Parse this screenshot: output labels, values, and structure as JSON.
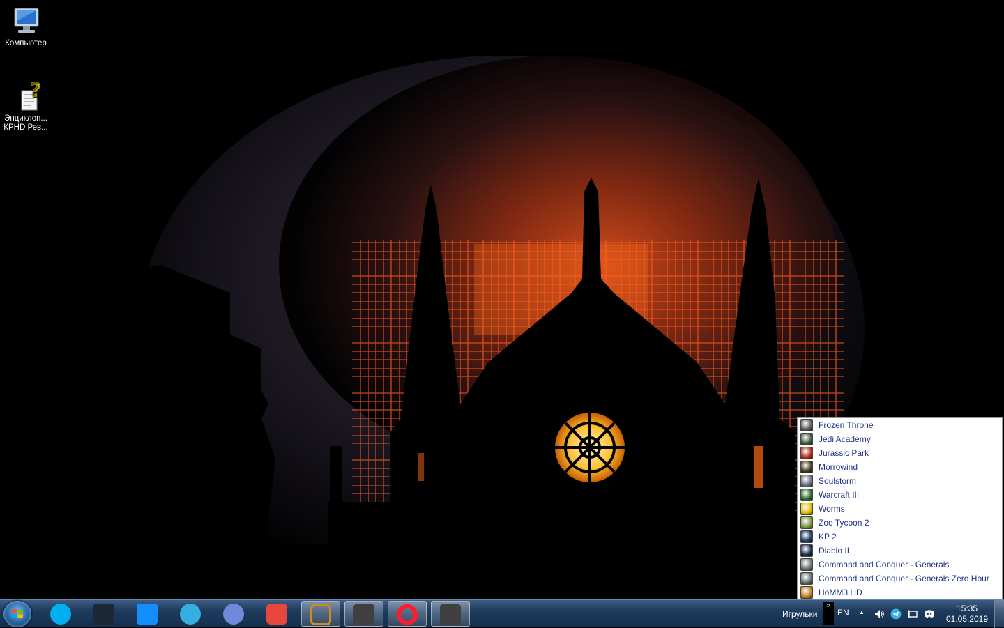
{
  "desktop": {
    "icons": [
      {
        "label": "Компьютер",
        "icon": "computer-icon"
      },
      {
        "label": "Энциклоп...",
        "label2": "КРHD Рев...",
        "icon": "encyclopedia-help-icon"
      }
    ]
  },
  "toolbar_menu": {
    "items": [
      {
        "label": "Frozen Throne",
        "icon": "frozen-throne-icon",
        "color": "#5a5a5a"
      },
      {
        "label": "Jedi Academy",
        "icon": "jedi-academy-icon",
        "color": "#3c5a3c"
      },
      {
        "label": "Jurassic Park",
        "icon": "jurassic-park-icon",
        "color": "#b03020"
      },
      {
        "label": "Morrowind",
        "icon": "morrowind-icon",
        "color": "#4a3a20"
      },
      {
        "label": "Soulstorm",
        "icon": "soulstorm-icon",
        "color": "#6a7080"
      },
      {
        "label": "Warcraft III",
        "icon": "warcraft-iii-icon",
        "color": "#2a6a2a"
      },
      {
        "label": "Worms",
        "icon": "worms-icon",
        "color": "#e0c000"
      },
      {
        "label": "Zoo Tycoon 2",
        "icon": "zoo-tycoon-icon",
        "color": "#7a9a40"
      },
      {
        "label": "KP 2",
        "icon": "kr2-icon",
        "color": "#203a6a"
      },
      {
        "label": "Diablo II",
        "icon": "diablo-ii-icon",
        "color": "#1a2a4a"
      },
      {
        "label": "Command and Conquer - Generals",
        "icon": "cnc-generals-icon",
        "color": "#707a70"
      },
      {
        "label": "Command and Conquer - Generals Zero Hour",
        "icon": "cnc-zero-hour-icon",
        "color": "#607070"
      },
      {
        "label": "HoMM3 HD",
        "icon": "homm3-icon",
        "color": "#c08020"
      }
    ]
  },
  "taskbar": {
    "pinned": [
      {
        "name": "skype",
        "icon": "skype-icon",
        "color": "#00aff0"
      },
      {
        "name": "steam",
        "icon": "steam-icon",
        "color": "#1b2838"
      },
      {
        "name": "battlenet",
        "icon": "battlenet-icon",
        "color": "#148eff"
      },
      {
        "name": "telegram",
        "icon": "telegram-icon",
        "color": "#37aee2"
      },
      {
        "name": "discord",
        "icon": "discord-icon",
        "color": "#7289da"
      },
      {
        "name": "app",
        "icon": "red-app-icon",
        "color": "#e8453c"
      },
      {
        "name": "switcher",
        "icon": "switch-arrows-icon",
        "color": "#d08a20"
      },
      {
        "name": "warband",
        "icon": "warband-icon",
        "color": "#404040"
      },
      {
        "name": "opera",
        "icon": "opera-icon",
        "color": "#ff1b2d"
      },
      {
        "name": "warband2",
        "icon": "warband-icon",
        "color": "#404040"
      }
    ],
    "toolbar_label": "Игрульки",
    "chevrons": "»",
    "language": "EN",
    "tray_up": "▲",
    "time": "15:35",
    "date": "01.05.2019"
  }
}
